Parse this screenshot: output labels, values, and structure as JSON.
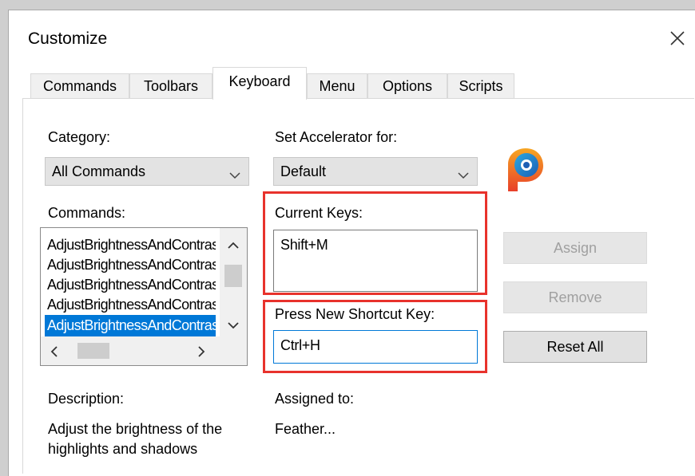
{
  "dialog": {
    "title": "Customize",
    "close_glyph": "✕"
  },
  "tabs": [
    {
      "label": "Commands",
      "active": false
    },
    {
      "label": "Toolbars",
      "active": false
    },
    {
      "label": "Keyboard",
      "active": true
    },
    {
      "label": "Menu",
      "active": false
    },
    {
      "label": "Options",
      "active": false
    },
    {
      "label": "Scripts",
      "active": false
    }
  ],
  "keyboard": {
    "category_label": "Category:",
    "category_value": "All Commands",
    "set_accel_label": "Set Accelerator for:",
    "set_accel_value": "Default",
    "commands_label": "Commands:",
    "commands": [
      "AdjustBrightnessAndContrast",
      "AdjustBrightnessAndContrast",
      "AdjustBrightnessAndContrast",
      "AdjustBrightnessAndContrast",
      "AdjustBrightnessAndContrast"
    ],
    "selected_command_index": 4,
    "current_keys_label": "Current Keys:",
    "current_keys_value": "Shift+M",
    "new_shortcut_label": "Press New Shortcut Key:",
    "new_shortcut_value": "Ctrl+H",
    "description_label": "Description:",
    "description_text_line1": "Adjust the brightness of the",
    "description_text_line2": "highlights and shadows",
    "assigned_label": "Assigned to:",
    "assigned_value": "Feather..."
  },
  "buttons": {
    "assign": "Assign",
    "remove": "Remove",
    "reset_all": "Reset All"
  },
  "colors": {
    "accent": "#0078d7",
    "highlight_box": "#e8322c"
  },
  "icons": {
    "logo": "paintshop-pro-logo-icon",
    "close": "close-icon"
  }
}
